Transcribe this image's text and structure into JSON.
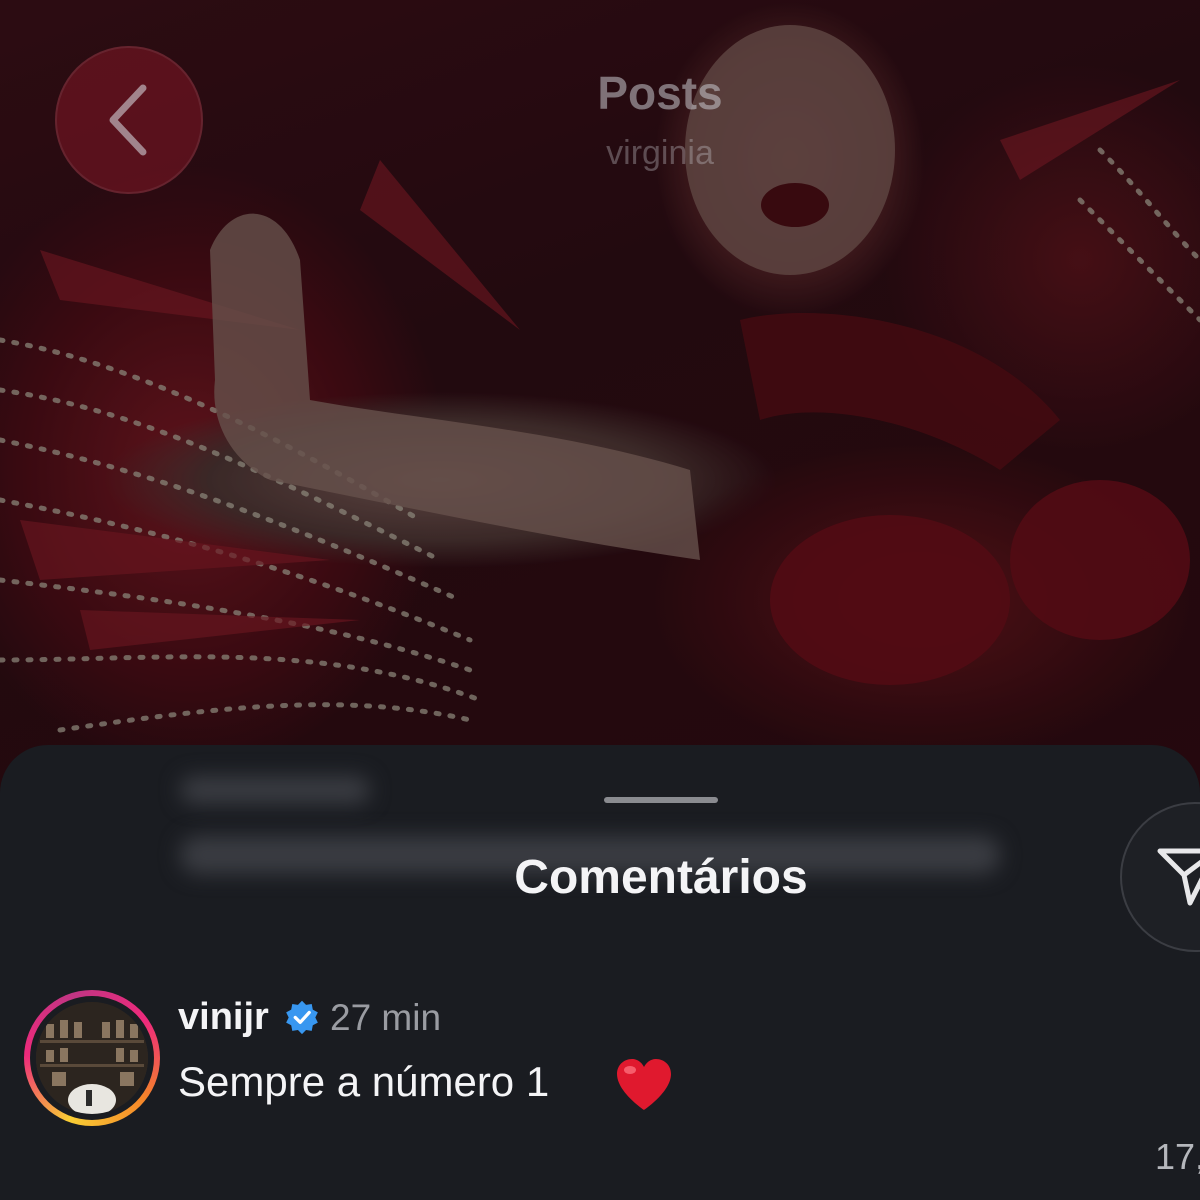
{
  "header": {
    "title": "Posts",
    "subtitle": "virginia"
  },
  "sheet": {
    "title": "Comentários"
  },
  "comment": {
    "username": "vinijr",
    "time": "27 min",
    "text": "Sempre a número 1",
    "emoji": "red-heart",
    "like_count": "17,",
    "verified": true
  },
  "icons": {
    "back": "chevron-left-icon",
    "share": "send-icon",
    "verified": "verified-badge-icon",
    "emoji": "heart-icon"
  },
  "colors": {
    "sheet_background": "#1a1c21",
    "verified_badge": "#3897f0",
    "heart": "#e0192e",
    "story_ring": "#ee2a7b"
  }
}
